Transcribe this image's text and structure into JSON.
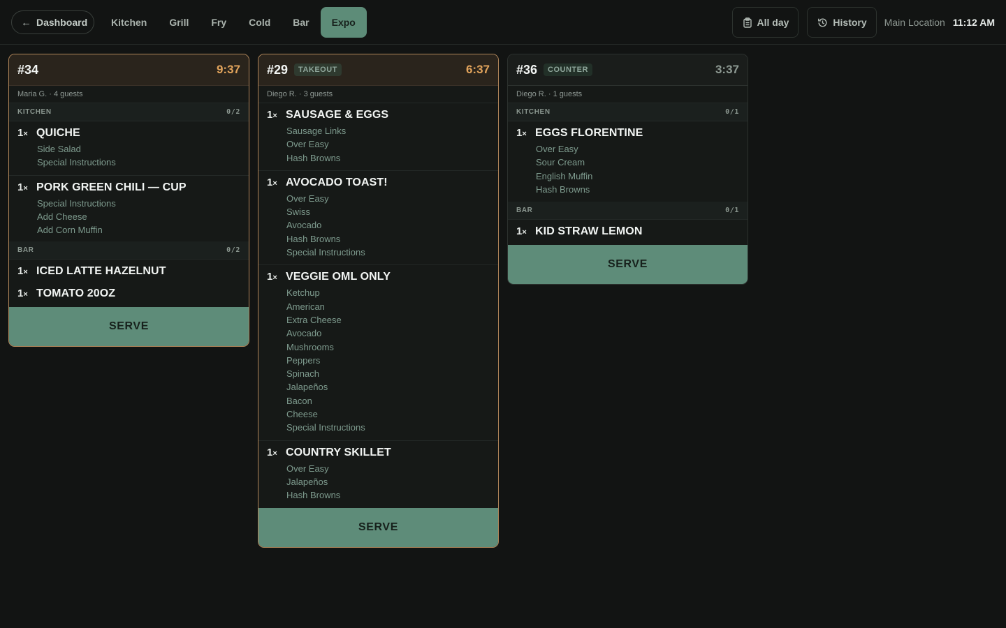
{
  "nav": {
    "back_label": "Dashboard",
    "tabs": [
      "Kitchen",
      "Grill",
      "Fry",
      "Cold",
      "Bar",
      "Expo"
    ],
    "active_tab": "Expo",
    "all_day_label": "All day",
    "history_label": "History",
    "location": "Main Location",
    "clock": "11:12 AM"
  },
  "colors": {
    "background": "#121413",
    "accent": "#5e8c79",
    "late_border": "#b1865a",
    "late_timer": "#e2a45c",
    "modifier_text": "#7e9b8e"
  },
  "tickets": [
    {
      "number": "#34",
      "badge": "",
      "timer": "9:37",
      "late": true,
      "guest_info": "Maria G. · 4 guests",
      "sections": [
        {
          "station": "KITCHEN",
          "progress": "0/2",
          "items": [
            {
              "qty": "1",
              "name": "QUICHE",
              "mods": [
                "Side Salad",
                "Special Instructions"
              ]
            },
            {
              "qty": "1",
              "name": "PORK GREEN CHILI — CUP",
              "mods": [
                "Special Instructions",
                "Add Cheese",
                "Add Corn Muffin"
              ]
            }
          ]
        },
        {
          "station": "BAR",
          "progress": "0/2",
          "items": [
            {
              "qty": "1",
              "name": "ICED LATTE HAZELNUT",
              "mods": []
            },
            {
              "qty": "1",
              "name": "TOMATO 20OZ",
              "mods": []
            }
          ]
        }
      ],
      "serve_label": "SERVE"
    },
    {
      "number": "#29",
      "badge": "TAKEOUT",
      "timer": "6:37",
      "late": true,
      "guest_info": "Diego R. · 3 guests",
      "sections": [
        {
          "station": "",
          "progress": "",
          "items": [
            {
              "qty": "1",
              "name": "SAUSAGE & EGGS",
              "mods": [
                "Sausage Links",
                "Over Easy",
                "Hash Browns"
              ]
            },
            {
              "qty": "1",
              "name": "AVOCADO TOAST!",
              "mods": [
                "Over Easy",
                "Swiss",
                "Avocado",
                "Hash Browns",
                "Special Instructions"
              ]
            },
            {
              "qty": "1",
              "name": "VEGGIE OML ONLY",
              "mods": [
                "Ketchup",
                "American",
                "Extra Cheese",
                "Avocado",
                "Mushrooms",
                "Peppers",
                "Spinach",
                "Jalapeños",
                "Bacon",
                "Cheese",
                "Special Instructions"
              ]
            },
            {
              "qty": "1",
              "name": "COUNTRY SKILLET",
              "mods": [
                "Over Easy",
                "Jalapeños",
                "Hash Browns"
              ]
            }
          ]
        }
      ],
      "serve_label": "SERVE"
    },
    {
      "number": "#36",
      "badge": "COUNTER",
      "timer": "3:37",
      "late": false,
      "guest_info": "Diego R. · 1 guests",
      "sections": [
        {
          "station": "KITCHEN",
          "progress": "0/1",
          "items": [
            {
              "qty": "1",
              "name": "EGGS FLORENTINE",
              "mods": [
                "Over Easy",
                "Sour Cream",
                "English Muffin",
                "Hash Browns"
              ]
            }
          ]
        },
        {
          "station": "BAR",
          "progress": "0/1",
          "items": [
            {
              "qty": "1",
              "name": "KID STRAW LEMON",
              "mods": []
            }
          ]
        }
      ],
      "serve_label": "SERVE"
    }
  ]
}
